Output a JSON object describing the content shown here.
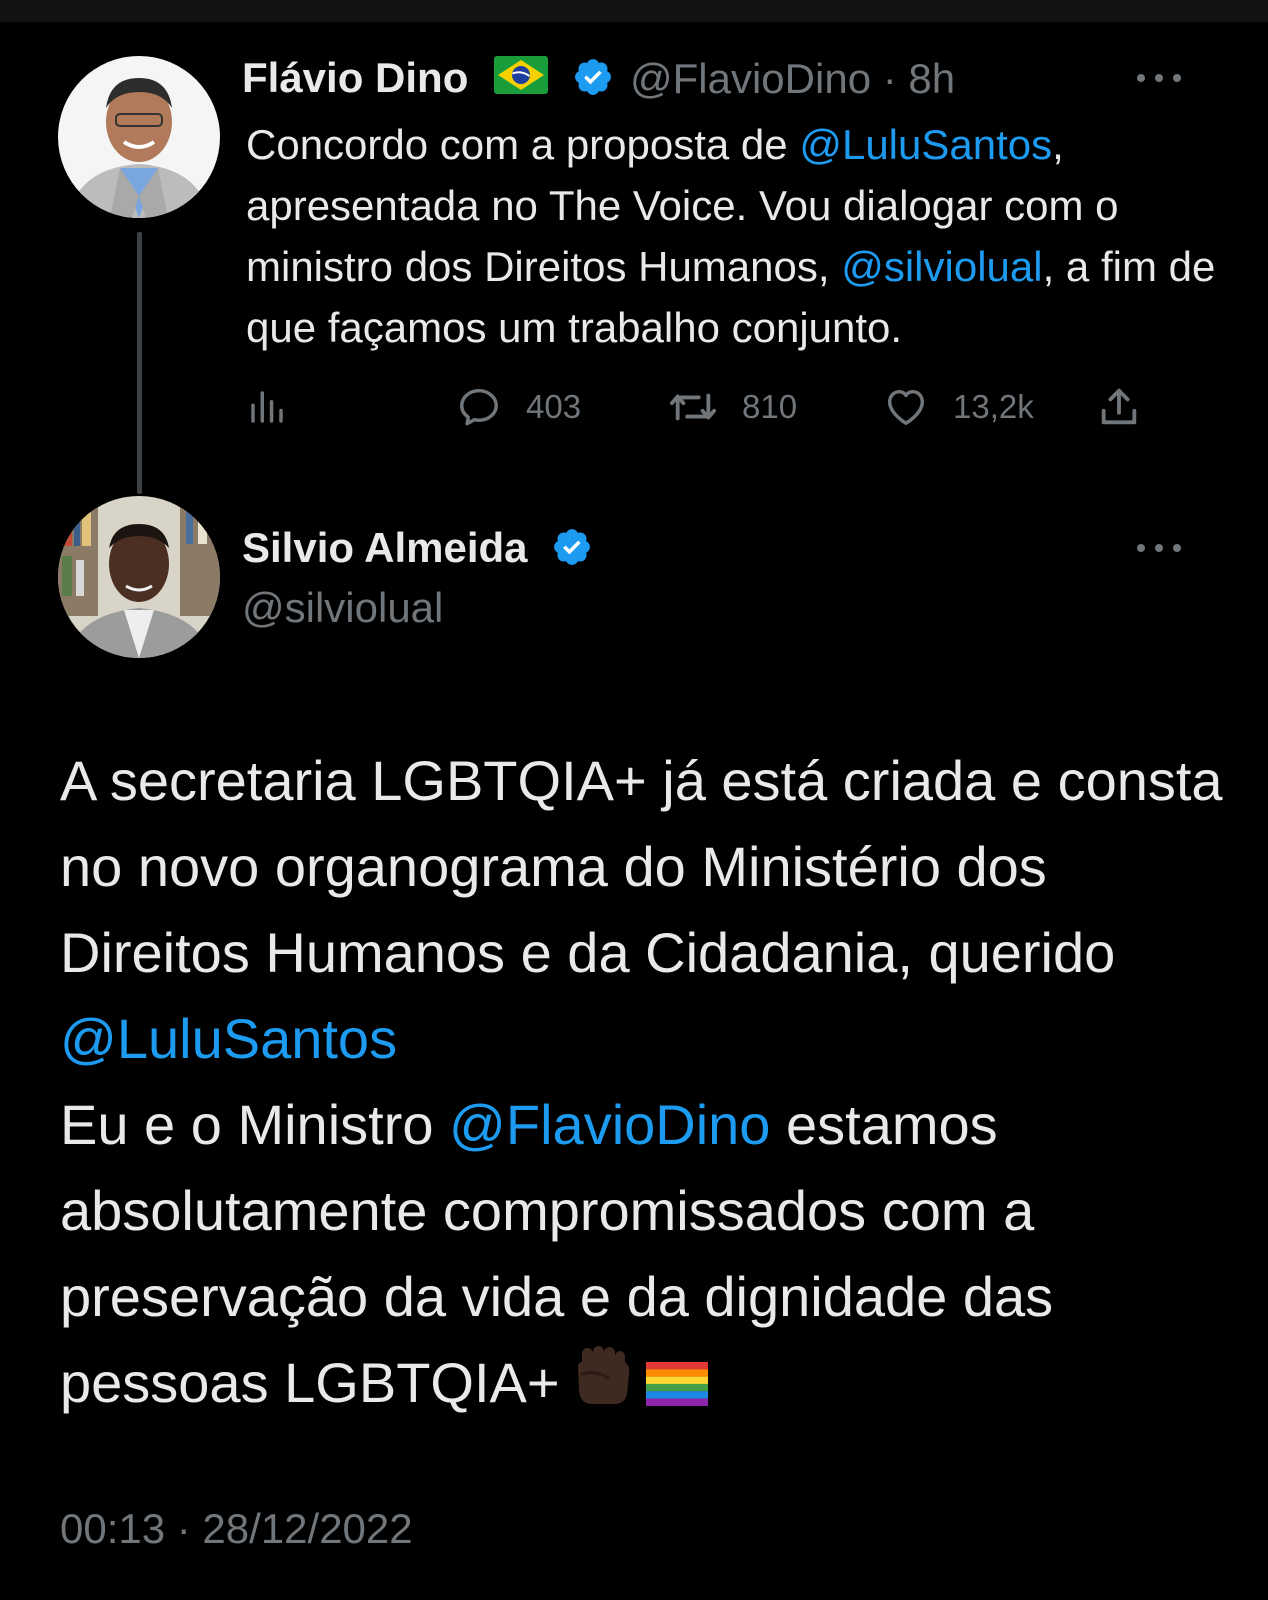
{
  "tweet1": {
    "author_name": "Flávio Dino",
    "author_flag": "🇧🇷",
    "author_handle": "@FlavioDino",
    "separator": "·",
    "time": "8h",
    "text_part1": "Concordo com a proposta de ",
    "mention1": "@LuluSantos",
    "text_part2": ", apresentada no The Voice. Vou dialogar com o ministro dos Direitos Humanos, ",
    "mention2": "@silviolual",
    "text_part3": ", a fim de que façamos um trabalho conjunto.",
    "stats": {
      "replies": "403",
      "retweets": "810",
      "likes": "13,2k"
    }
  },
  "tweet2": {
    "author_name": "Silvio Almeida",
    "author_handle": "@silviolual",
    "text_part1": "A secretaria LGBTQIA+ já está criada e consta no novo organograma do Ministério dos Direitos Humanos e da Cidadania, querido ",
    "mention1": "@LuluSantos",
    "text_part2": "Eu e o Ministro ",
    "mention2": "@FlavioDino",
    "text_part3": " estamos absolutamente compromissados com a preservação da vida e da dignidade das pessoas LGBTQIA+",
    "emojis": [
      "raised-fist-dark-skin",
      "rainbow-flag"
    ],
    "timestamp": "00:13 · 28/12/2022"
  },
  "colors": {
    "background": "#000000",
    "text": "#e7e9ea",
    "secondary": "#71767b",
    "accent": "#1d9bf0",
    "thread_line": "#3d4144"
  }
}
